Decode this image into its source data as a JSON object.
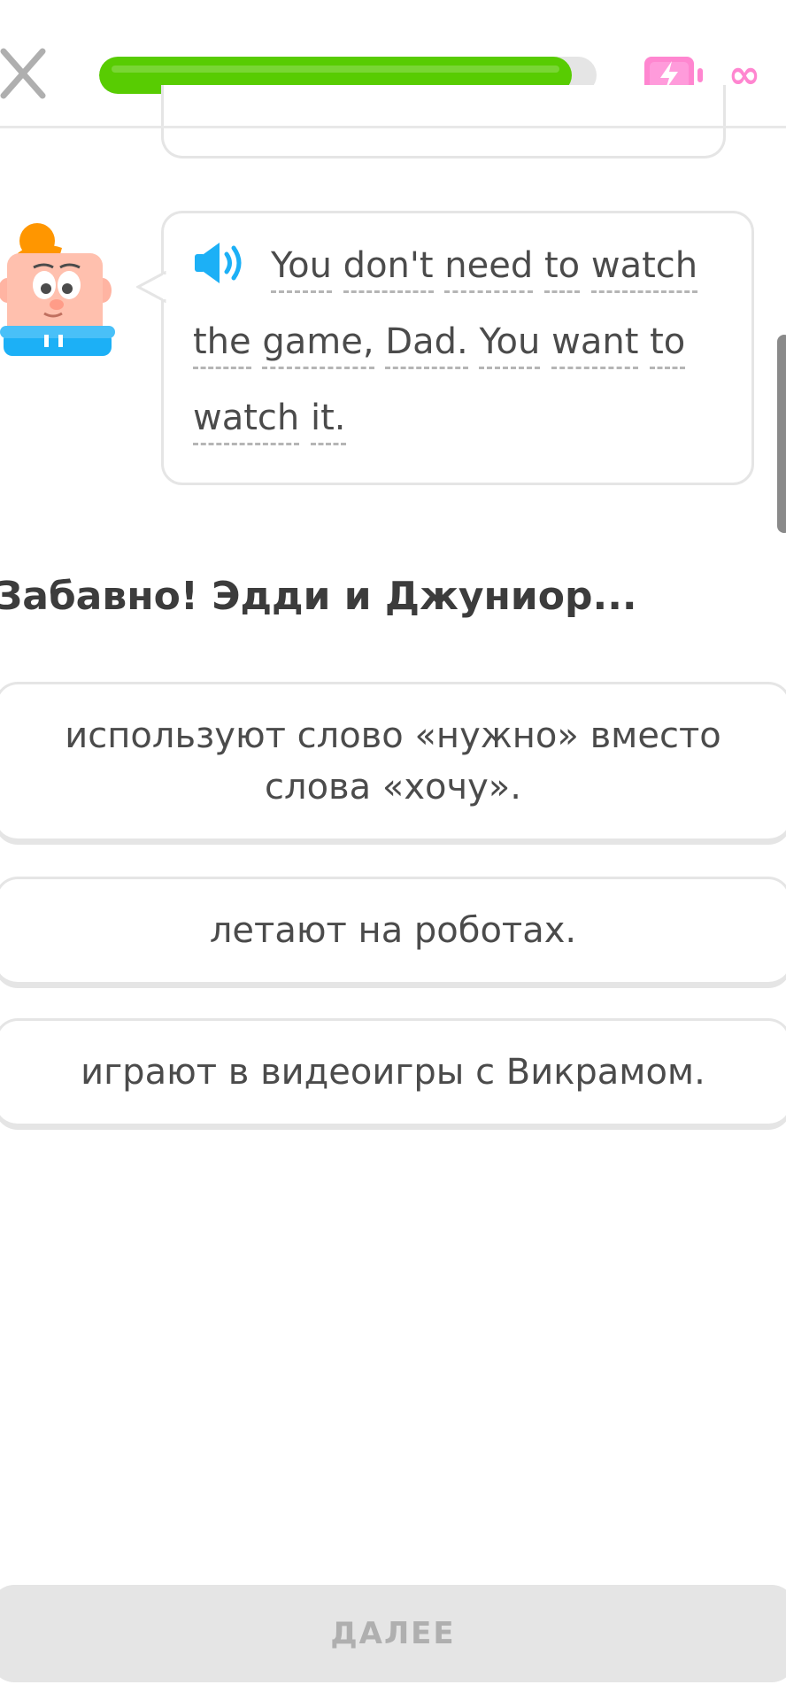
{
  "header": {
    "close_icon": "close-x-icon",
    "progress": 0.95,
    "energy_icon": "battery-lightning-icon",
    "energy_value": "∞",
    "accent_progress": "#58cc02",
    "accent_energy": "#ff86d0"
  },
  "dialogue": {
    "speaker_icon": "speaker-icon",
    "line1": [
      "You",
      "don't",
      "need",
      "to",
      "watch"
    ],
    "line2": [
      "the",
      "game,",
      "Dad.",
      "You",
      "want",
      "to"
    ],
    "line3": [
      "watch",
      "it."
    ]
  },
  "question": "Забавно! Эдди и Джуниор...",
  "options": [
    {
      "label_line1": "используют слово «нужно» вместо",
      "label_line2": "слова «хочу»."
    },
    {
      "label": "летают на роботах."
    },
    {
      "label": "играют в видеоигры с Викрамом."
    }
  ],
  "footer": {
    "continue_label": "ДАЛЕЕ"
  }
}
